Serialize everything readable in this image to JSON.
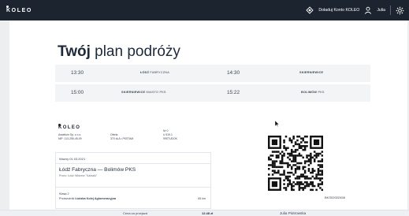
{
  "header": {
    "logo": "KOLEO",
    "top_up_label": "Doładuj Konto KOLEO",
    "user_name": "Julia"
  },
  "page": {
    "title_bold": "Twój",
    "title_rest": "plan podróży"
  },
  "route": [
    {
      "dep_time": "13:30",
      "dep_station_bold": "ŁÓDŹ",
      "dep_station_rest": "FABRYCZNA",
      "arr_time": "14:30",
      "arr_station_bold": "SKIERNIEWICE",
      "arr_station_rest": ""
    },
    {
      "dep_time": "15:00",
      "dep_station_bold": "SKIERNIEWICE",
      "dep_station_rest": "MIASTO PKS",
      "arr_time": "15:22",
      "arr_station_bold": "BOLIMÓW",
      "arr_station_rest": "PKS"
    }
  ],
  "ticket": {
    "logo": "KOLEO",
    "seller_line1": "Asseltum Sp. z o.o.",
    "seller_line2": "NIP: 113-255-45-09",
    "offer_line1": "Oferta",
    "offer_line2": "370 dLA • PKSTAM",
    "number_line1": "Nr 0",
    "number_line2": "U 519.1",
    "number_line3": "99STUDOK",
    "valid": "Ważny 01.03.2021",
    "route_title": "Łódź Fabryczna — Bolimów PKS",
    "route_via": "Przez: Łódź Widzew \"Kaliszki\"",
    "class_label": "Klasa 2",
    "carrier_prefix": "Przewoźnik",
    "carrier_name": "Łódzka Kolej Aglomeracyjna",
    "distance": "65 km",
    "price_label": "Cena za przejazd",
    "price": "12.48 zł",
    "code": "BKS02002458",
    "passenger": "Julia Piotrowska"
  }
}
